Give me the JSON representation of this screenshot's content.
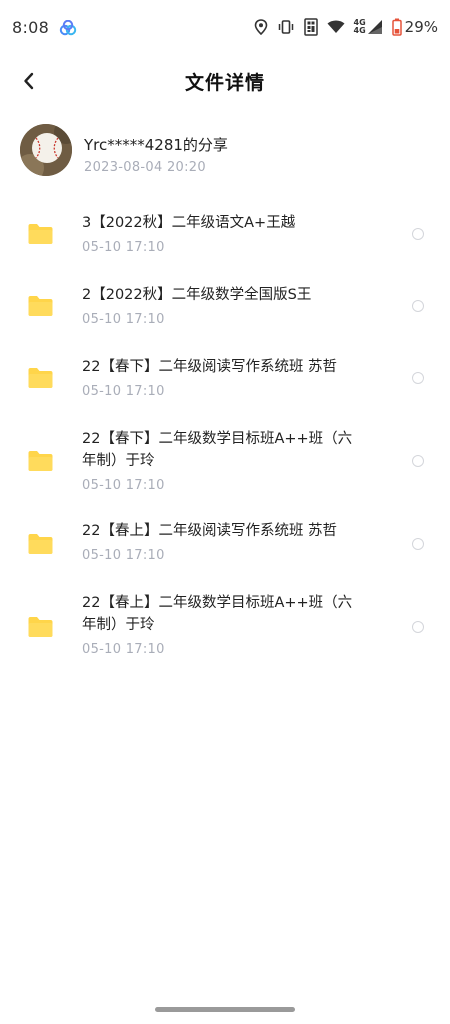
{
  "status_bar": {
    "time": "8:08",
    "network_top": "4G",
    "network_bottom": "4G",
    "battery": "29%",
    "icons": [
      "app-notification-icon",
      "location-icon",
      "vibrate-icon",
      "nfc-icon",
      "wifi-icon",
      "signal-icon",
      "battery-icon"
    ]
  },
  "header": {
    "title": "文件详情",
    "back_icon": "chevron-left-icon"
  },
  "share": {
    "title": "Yrc*****4281的分享",
    "time": "2023-08-04  20:20",
    "avatar": "baseball-avatar"
  },
  "files": [
    {
      "name": "3【2022秋】二年级语文A+王越",
      "date": "05-10  17:10",
      "icon": "folder-icon"
    },
    {
      "name": "2【2022秋】二年级数学全国版S王",
      "date": "05-10  17:10",
      "icon": "folder-icon"
    },
    {
      "name": "22【春下】二年级阅读写作系统班 苏哲",
      "date": "05-10  17:10",
      "icon": "folder-icon"
    },
    {
      "name": "22【春下】二年级数学目标班A++班（六年制）于玲",
      "date": "05-10  17:10",
      "icon": "folder-icon"
    },
    {
      "name": "22【春上】二年级阅读写作系统班 苏哲",
      "date": "05-10  17:10",
      "icon": "folder-icon"
    },
    {
      "name": "22【春上】二年级数学目标班A++班（六年制）于玲",
      "date": "05-10  17:10",
      "icon": "folder-icon"
    }
  ],
  "colors": {
    "folder": "#FFD54A",
    "secondary_text": "#A9ADB8",
    "primary_text": "#222222",
    "battery_accent": "#E5533A"
  }
}
